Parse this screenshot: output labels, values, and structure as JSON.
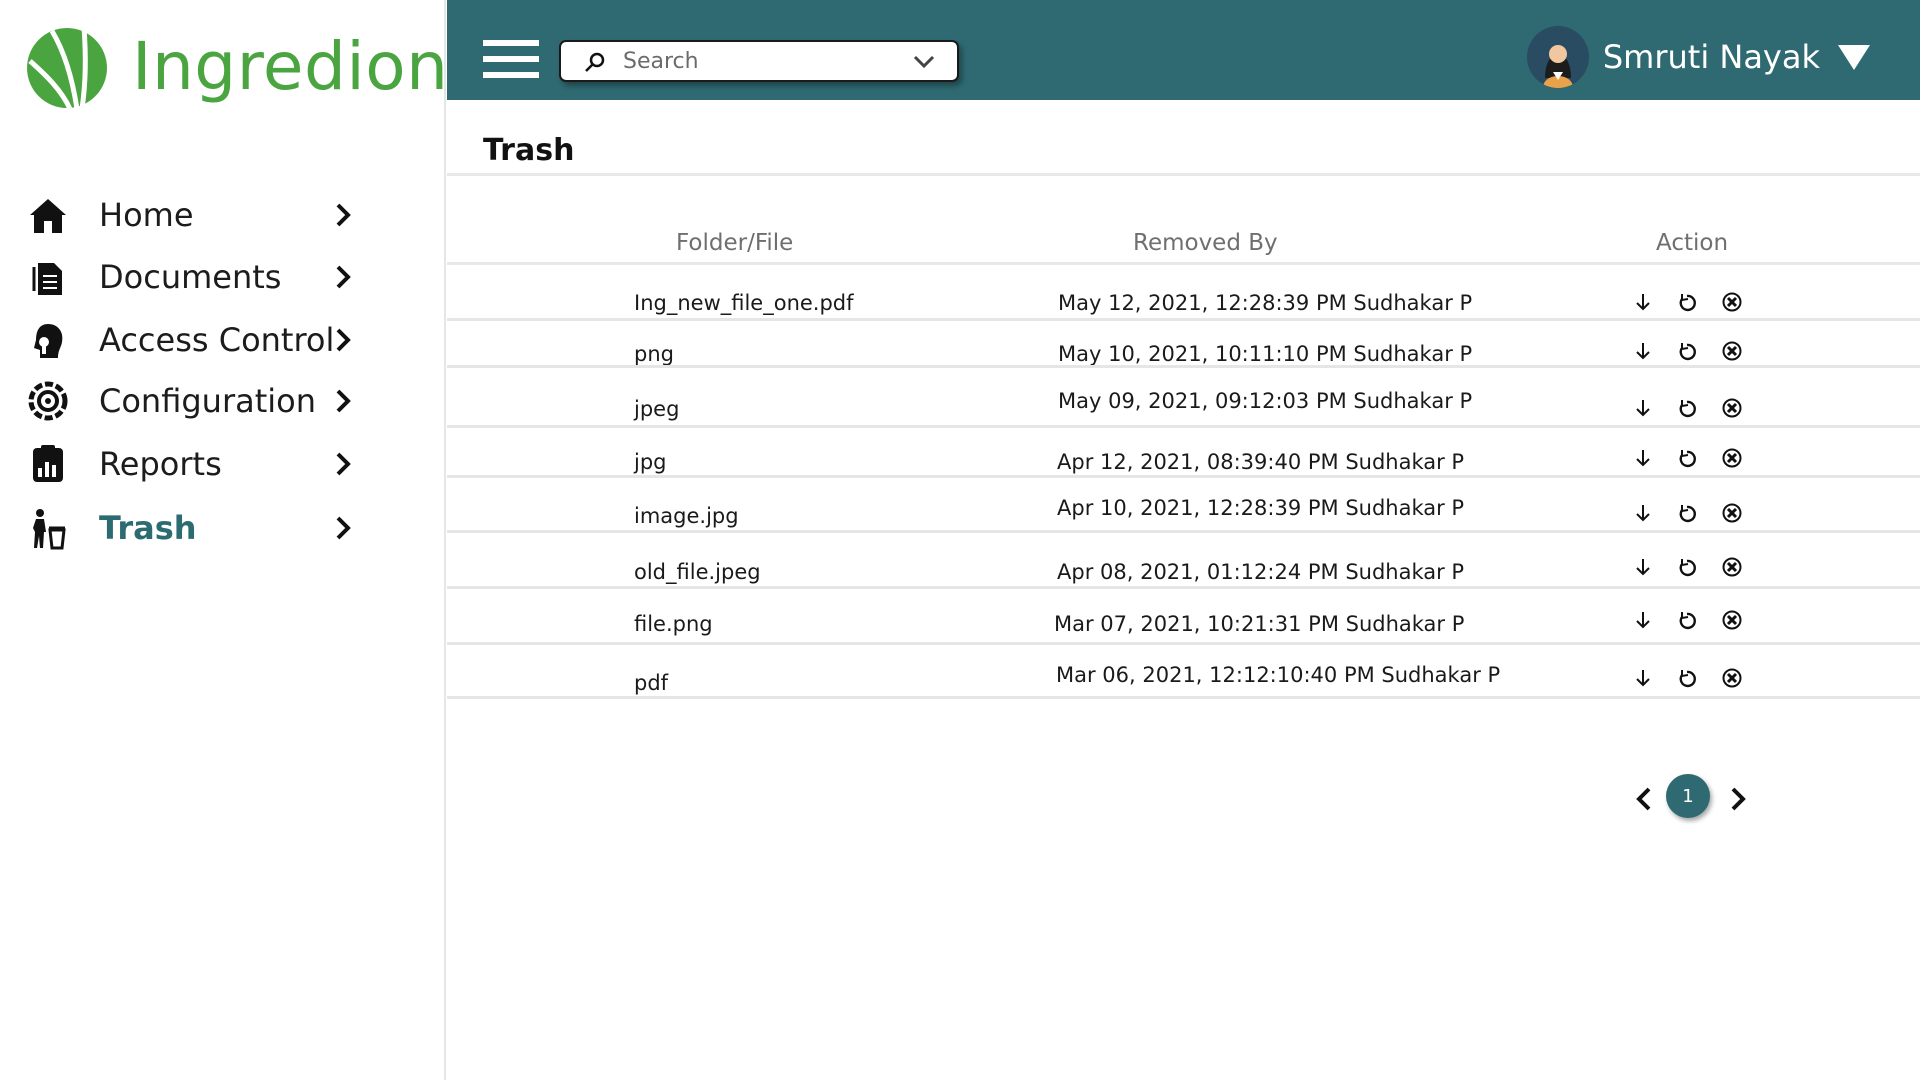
{
  "brand": {
    "name": "Ingredion",
    "color": "#4aa540"
  },
  "theme": {
    "topbar": "#2f6a72",
    "active": "#2d6b72"
  },
  "sidebar": {
    "items": [
      {
        "label": "Home",
        "icon": "home-icon"
      },
      {
        "label": "Documents",
        "icon": "document-icon"
      },
      {
        "label": "Access Control",
        "icon": "access-control-icon"
      },
      {
        "label": "Configuration",
        "icon": "configuration-icon"
      },
      {
        "label": "Reports",
        "icon": "reports-icon"
      },
      {
        "label": "Trash",
        "icon": "trash-person-icon",
        "active": true
      }
    ]
  },
  "header": {
    "search": {
      "placeholder": "Search"
    },
    "user": {
      "name": "Smruti Nayak"
    }
  },
  "main": {
    "title": "Trash",
    "columns": [
      "Folder/File",
      "Removed By",
      "Action"
    ],
    "rows": [
      {
        "file": "Ing_new_file_one.pdf",
        "removed": "May 12, 2021, 12:28:39  PM  Sudhakar P"
      },
      {
        "file": "png",
        "removed": "May 10, 2021, 10:11:10  PM  Sudhakar P"
      },
      {
        "file": "jpeg",
        "removed": "May 09, 2021, 09:12:03 PM  Sudhakar P"
      },
      {
        "file": "jpg",
        "removed": "Apr 12, 2021, 08:39:40  PM  Sudhakar P"
      },
      {
        "file": "image.jpg",
        "removed": "Apr 10, 2021, 12:28:39  PM  Sudhakar P"
      },
      {
        "file": "old_file.jpeg",
        "removed": "Apr 08, 2021, 01:12:24 PM  Sudhakar P"
      },
      {
        "file": "file.png",
        "removed": "Mar 07, 2021, 10:21:31  PM  Sudhakar P"
      },
      {
        "file": "pdf",
        "removed": "Mar 06, 2021, 12:12:10:40 PM  Sudhakar P"
      }
    ],
    "actions": [
      "download-icon",
      "restore-icon",
      "delete-icon"
    ]
  },
  "pagination": {
    "current": "1"
  }
}
